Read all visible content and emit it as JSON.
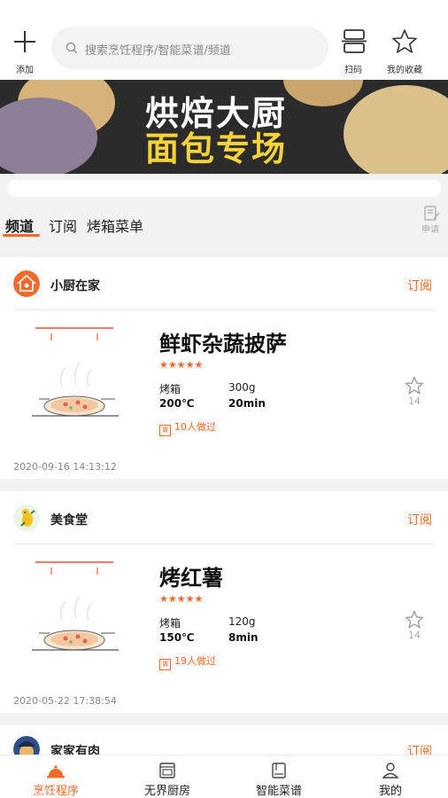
{
  "header": {
    "add_label": "添加",
    "search_placeholder": "搜索烹饪程序/智能菜谱/频道",
    "scan_label": "扫码",
    "favorites_label": "我的收藏"
  },
  "banner": {
    "title_line1": "烘焙大厨",
    "title_line2": "面包专场"
  },
  "tabs": {
    "items": [
      "频道",
      "订阅",
      "烤箱菜单"
    ],
    "apply_label": "申请"
  },
  "cards": [
    {
      "channel": "小厨在家",
      "subscribe": "订阅",
      "recipe": "鲜虾杂蔬披萨",
      "stars": "★★★★★",
      "device": "烤箱",
      "weight": "300g",
      "temperature": "200℃",
      "time": "20min",
      "made": "10人做过",
      "fav_count": "14",
      "date": "2020-09-16 14:13:12"
    },
    {
      "channel": "美食堂",
      "subscribe": "订阅",
      "recipe": "烤红薯",
      "stars": "★★★★★",
      "device": "烤箱",
      "weight": "120g",
      "temperature": "150℃",
      "time": "8min",
      "made": "19人做过",
      "fav_count": "14",
      "date": "2020-05-22 17:38:54"
    },
    {
      "channel": "家家有肉",
      "subscribe": "订阅"
    }
  ],
  "made_icon": "做",
  "bottom_nav": {
    "items": [
      "烹饪程序",
      "无界厨房",
      "智能菜谱",
      "我的"
    ],
    "active_index": 0
  },
  "colors": {
    "accent": "#f26a2a",
    "background": "#f2f2f2"
  }
}
